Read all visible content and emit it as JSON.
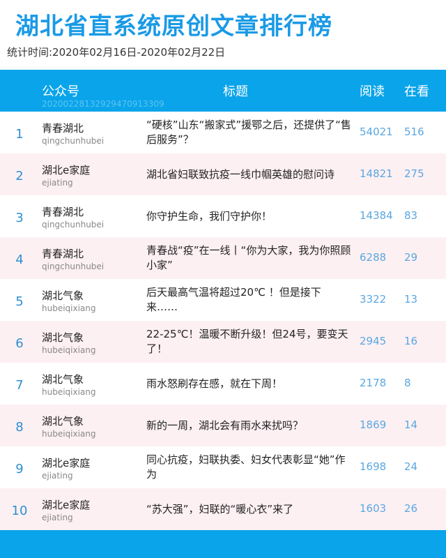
{
  "page": {
    "title": "湖北省直系统原创文章排行榜",
    "period": "统计时间:2020年02月16日-2020年02月22日"
  },
  "table": {
    "headers": {
      "account": "公众号",
      "title": "标题",
      "reads": "阅读",
      "likes": "在看"
    },
    "code": "20200228132929470913309",
    "rows": [
      {
        "rank": "1",
        "account": "青春湖北",
        "account_id": "qingchunhubei",
        "title": "“硬核”山东“搬家式”援鄂之后，还提供了“售后服务”？",
        "reads": "54021",
        "likes": "516"
      },
      {
        "rank": "2",
        "account": "湖北e家庭",
        "account_id": "ejiating",
        "title": "湖北省妇联致抗疫一线巾帼英雄的慰问诗",
        "reads": "14821",
        "likes": "275"
      },
      {
        "rank": "3",
        "account": "青春湖北",
        "account_id": "qingchunhubei",
        "title": "你守护生命，我们守护你！",
        "reads": "14384",
        "likes": "83"
      },
      {
        "rank": "4",
        "account": "青春湖北",
        "account_id": "qingchunhubei",
        "title": "青春战“疫”在一线丨“你为大家，我为你照顾小家”",
        "reads": "6288",
        "likes": "29"
      },
      {
        "rank": "5",
        "account": "湖北气象",
        "account_id": "hubeiqixiang",
        "title": "后天最高气温将超过20℃ ！但是接下来……",
        "reads": "3322",
        "likes": "13"
      },
      {
        "rank": "6",
        "account": "湖北气象",
        "account_id": "hubeiqixiang",
        "title": "22-25℃！温暖不断升级！但24号，要变天了！",
        "reads": "2945",
        "likes": "16"
      },
      {
        "rank": "7",
        "account": "湖北气象",
        "account_id": "hubeiqixiang",
        "title": "雨水怒刷存在感，就在下周！",
        "reads": "2178",
        "likes": "8"
      },
      {
        "rank": "8",
        "account": "湖北气象",
        "account_id": "hubeiqixiang",
        "title": "新的一周，湖北会有雨水来扰吗？",
        "reads": "1869",
        "likes": "14"
      },
      {
        "rank": "9",
        "account": "湖北e家庭",
        "account_id": "ejiating",
        "title": "同心抗疫，妇联执委、妇女代表彰显“她”作为",
        "reads": "1698",
        "likes": "24"
      },
      {
        "rank": "10",
        "account": "湖北e家庭",
        "account_id": "ejiating",
        "title": "“苏大强”，妇联的“暖心衣”来了",
        "reads": "1603",
        "likes": "26"
      }
    ]
  },
  "colors": {
    "accent": "#0aa4ea",
    "title": "#1a9ae6",
    "row_alt": "#fdf0f3",
    "number": "#5aa7e0"
  }
}
